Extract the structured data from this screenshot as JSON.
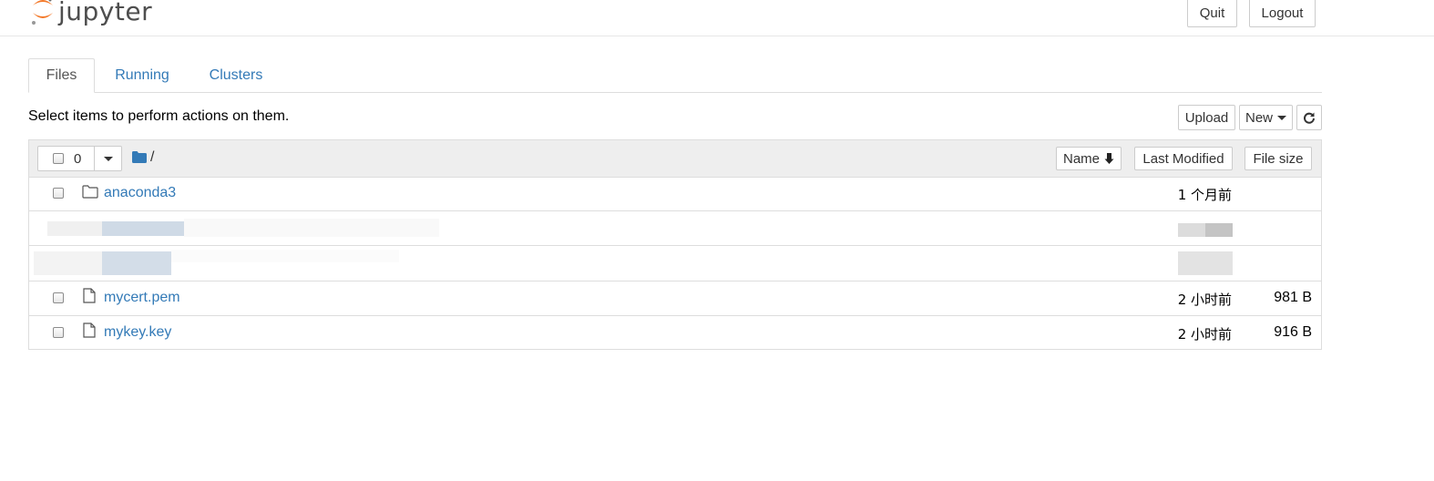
{
  "header": {
    "logo_text": "jupyter",
    "quit_label": "Quit",
    "logout_label": "Logout"
  },
  "tabs": [
    {
      "label": "Files"
    },
    {
      "label": "Running"
    },
    {
      "label": "Clusters"
    }
  ],
  "toolbar": {
    "hint": "Select items to perform actions on them.",
    "upload_label": "Upload",
    "new_label": "New"
  },
  "list": {
    "selected_count": "0",
    "breadcrumb_path": "/",
    "sort_name_label": "Name",
    "sort_modified_label": "Last Modified",
    "sort_size_label": "File size",
    "rows": [
      {
        "name": "anaconda3",
        "type": "folder",
        "modified": "1 个月前",
        "size": ""
      },
      {
        "name": "mycert.pem",
        "type": "file",
        "modified": "2 小时前",
        "size": "981 B"
      },
      {
        "name": "mykey.key",
        "type": "file",
        "modified": "2 小时前",
        "size": "916 B"
      }
    ]
  },
  "colors": {
    "link": "#337ab7",
    "jupyter_orange": "#f37726",
    "header_gray": "#eeeeee",
    "folder_blue": "#337ab7"
  },
  "icons": [
    "jupyter-logo",
    "chevron-down-icon",
    "folder-icon",
    "file-icon",
    "refresh-icon",
    "arrow-down-icon"
  ]
}
